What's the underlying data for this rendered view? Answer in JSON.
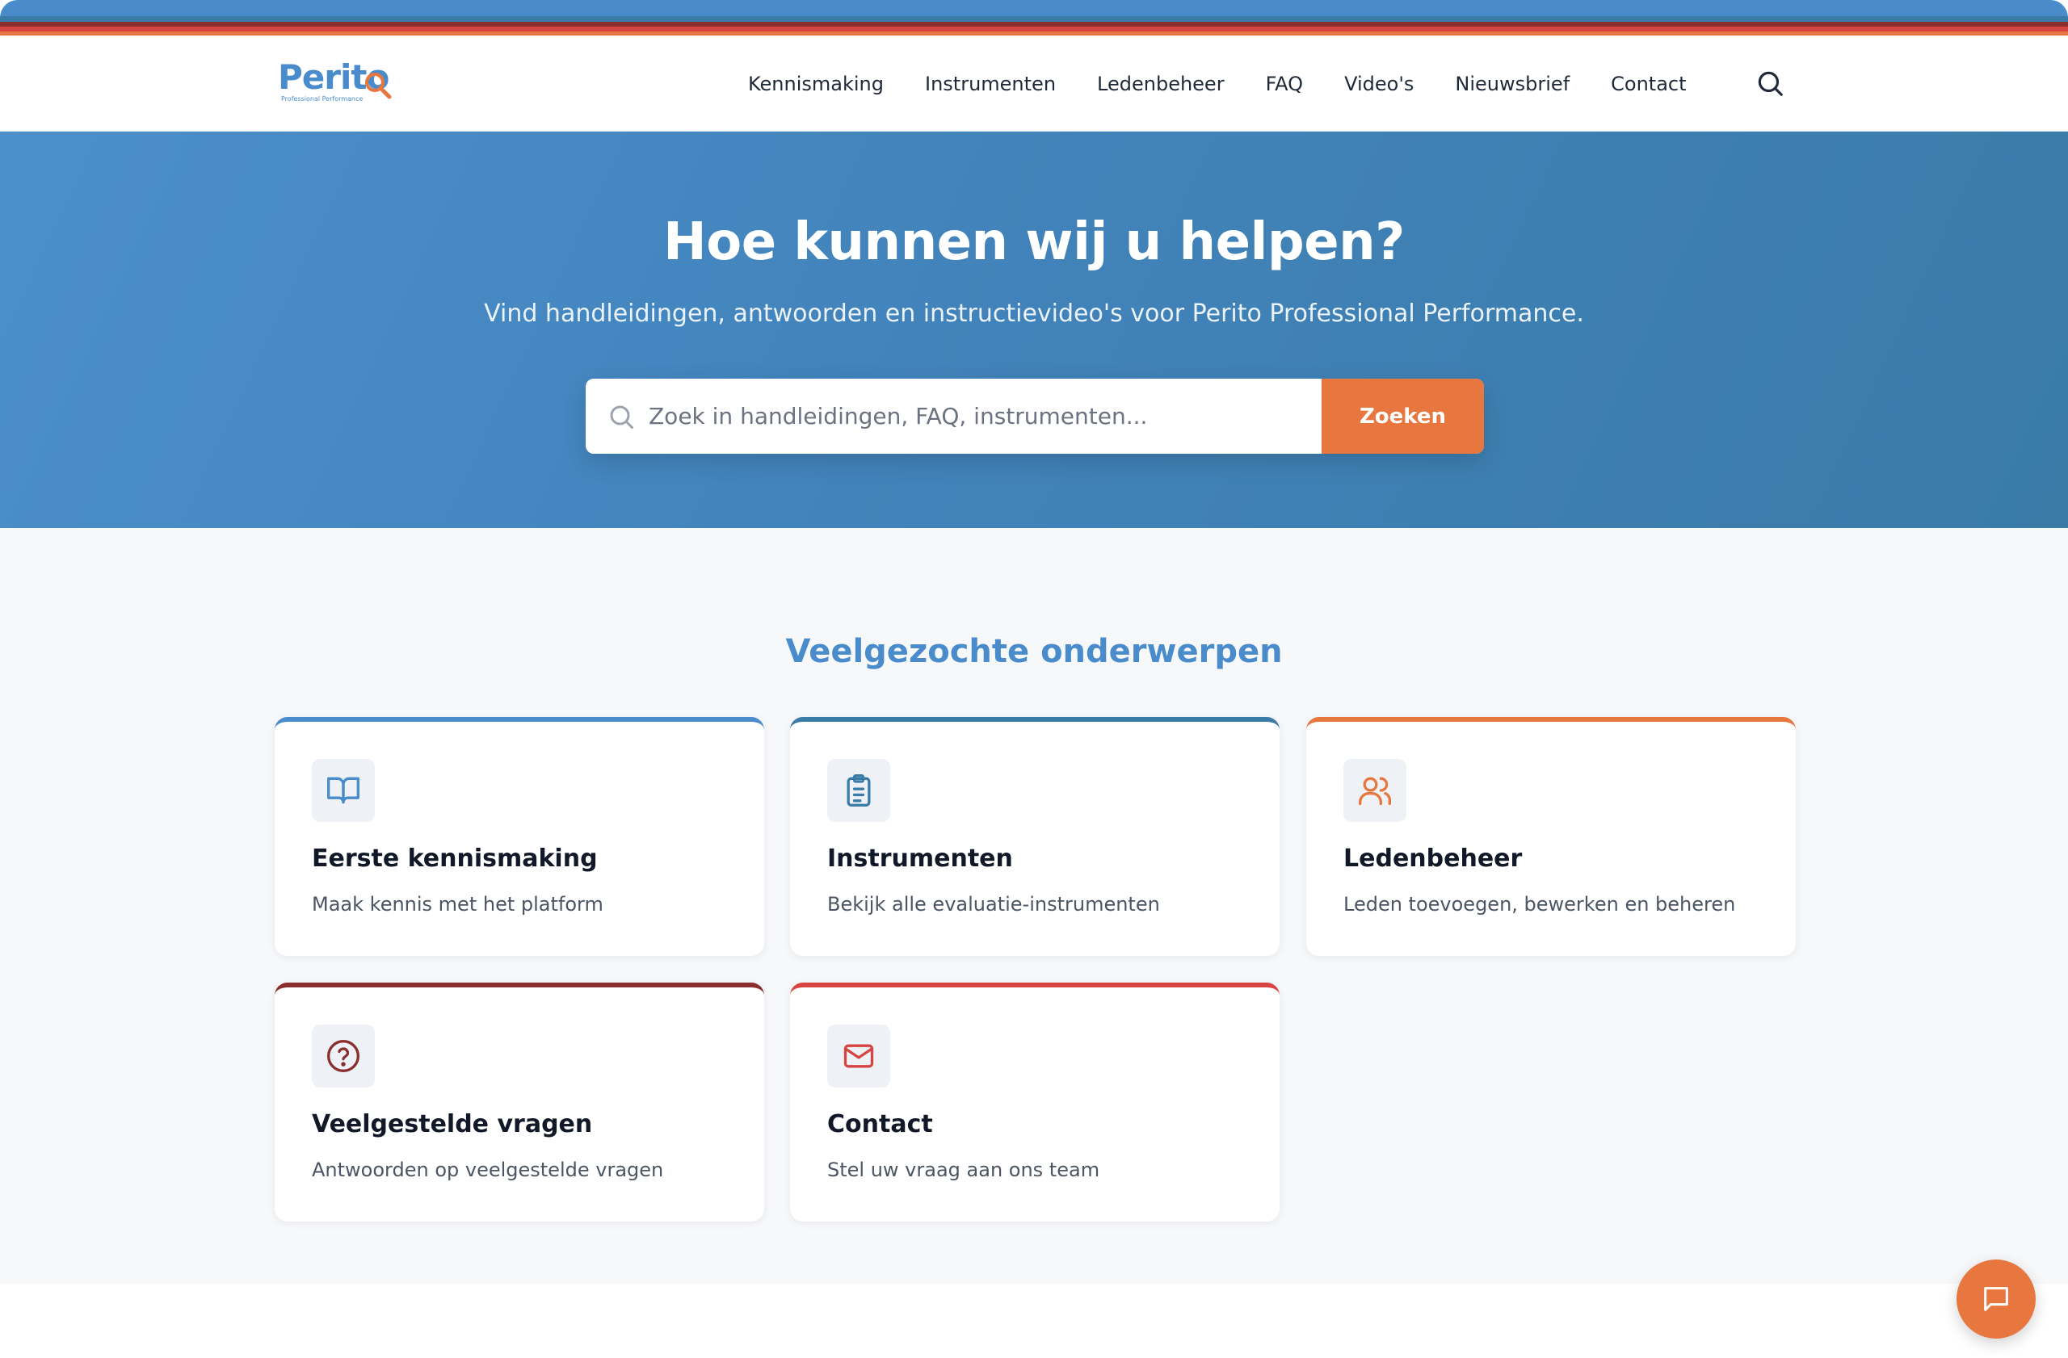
{
  "brand": {
    "name": "Perito",
    "tagline": "Professional Performance",
    "colors": {
      "primary_blue": "#4a8ccb",
      "dark_blue": "#3a7ba8",
      "orange": "#e8763f",
      "dark_red": "#8b2e2e",
      "red": "#d64541"
    }
  },
  "top_stripes": [
    "#4a8ccb",
    "#3a7ba8",
    "#8b2e2e",
    "#d64541",
    "#e8763f"
  ],
  "nav": {
    "items": [
      "Kennismaking",
      "Instrumenten",
      "Ledenbeheer",
      "FAQ",
      "Video's",
      "Nieuwsbrief",
      "Contact"
    ],
    "search_icon": "search-icon"
  },
  "hero": {
    "title": "Hoe kunnen wij u helpen?",
    "subtitle": "Vind handleidingen, antwoorden en instructievideo's voor Perito Professional Performance.",
    "search": {
      "placeholder": "Zoek in handleidingen, FAQ, instrumenten...",
      "value": "",
      "button_label": "Zoeken"
    }
  },
  "topics": {
    "title": "Veelgezochte onderwerpen",
    "cards": [
      {
        "title": "Eerste kennismaking",
        "description": "Maak kennis met het platform",
        "icon": "book-open-icon",
        "accent": "#4a8ccb"
      },
      {
        "title": "Instrumenten",
        "description": "Bekijk alle evaluatie-instrumenten",
        "icon": "clipboard-list-icon",
        "accent": "#3a7ba8"
      },
      {
        "title": "Ledenbeheer",
        "description": "Leden toevoegen, bewerken en beheren",
        "icon": "users-icon",
        "accent": "#e8763f"
      },
      {
        "title": "Veelgestelde vragen",
        "description": "Antwoorden op veelgestelde vragen",
        "icon": "help-circle-icon",
        "accent": "#8b2e2e"
      },
      {
        "title": "Contact",
        "description": "Stel uw vraag aan ons team",
        "icon": "mail-icon",
        "accent": "#d64541"
      }
    ]
  },
  "chat": {
    "icon": "chat-bubble-icon"
  }
}
